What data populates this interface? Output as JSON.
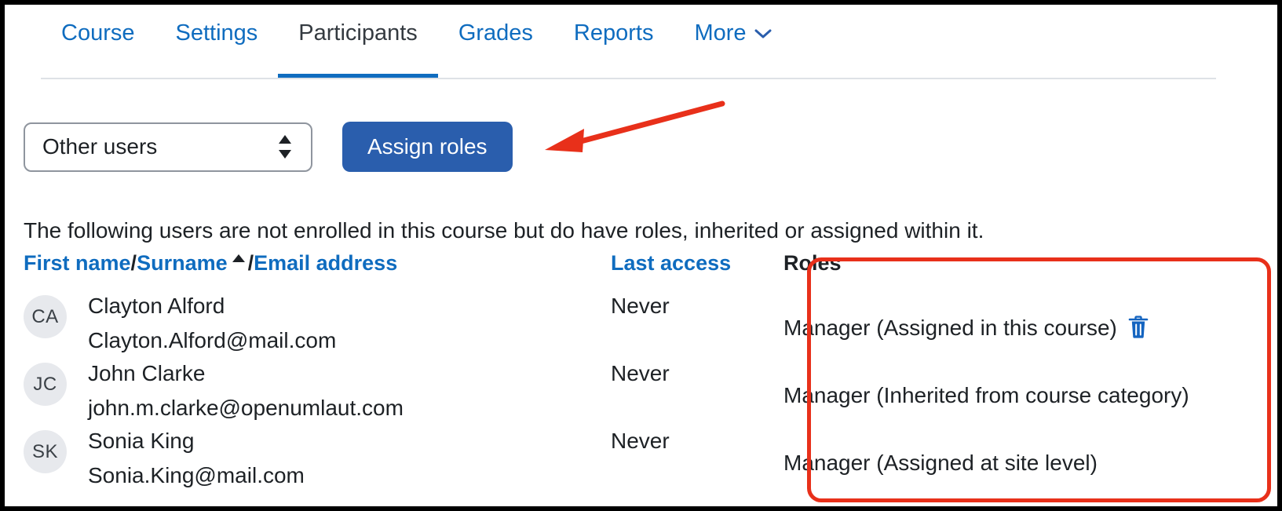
{
  "colors": {
    "link_blue": "#0f6cbf",
    "button_blue": "#2a5ead",
    "annotation_red": "#e8301a",
    "text_dark": "#1d2125",
    "avatar_bg": "#e7e9ed"
  },
  "navigation": {
    "tabs": [
      {
        "label": "Course",
        "active": false,
        "has_chevron": false
      },
      {
        "label": "Settings",
        "active": false,
        "has_chevron": false
      },
      {
        "label": "Participants",
        "active": true,
        "has_chevron": false
      },
      {
        "label": "Grades",
        "active": false,
        "has_chevron": false
      },
      {
        "label": "Reports",
        "active": false,
        "has_chevron": false
      },
      {
        "label": "More",
        "active": false,
        "has_chevron": true
      }
    ],
    "more_chevron_glyph": "˅"
  },
  "toolbar": {
    "participants_filter": {
      "selected": "Other users",
      "icon": "updown-arrows-icon"
    },
    "assign_roles_label": "Assign roles"
  },
  "annotation": {
    "arrow_icon": "red-arrow-icon",
    "highlight_box_icon": "red-highlight-rectangle"
  },
  "main": {
    "intro_text": "The following users are not enrolled in this course but do have roles, inherited or assigned within it.",
    "table": {
      "headers": {
        "first_name": "First name",
        "separator": "/",
        "surname": "Surname",
        "sort_caret": "▲",
        "email_address": "Email address",
        "last_access": "Last access",
        "roles": "Roles"
      },
      "rows": [
        {
          "initials": "CA",
          "name": "Clayton Alford",
          "email": "Clayton.Alford@mail.com",
          "last_access": "Never",
          "role": "Manager (Assigned in this course)",
          "has_delete": true,
          "delete_icon": "trash-icon"
        },
        {
          "initials": "JC",
          "name": "John Clarke",
          "email": "john.m.clarke@openumlaut.com",
          "last_access": "Never",
          "role": "Manager (Inherited from course category)",
          "has_delete": false,
          "delete_icon": ""
        },
        {
          "initials": "SK",
          "name": "Sonia King",
          "email": "Sonia.King@mail.com",
          "last_access": "Never",
          "role": "Manager (Assigned at site level)",
          "has_delete": false,
          "delete_icon": ""
        }
      ]
    }
  }
}
